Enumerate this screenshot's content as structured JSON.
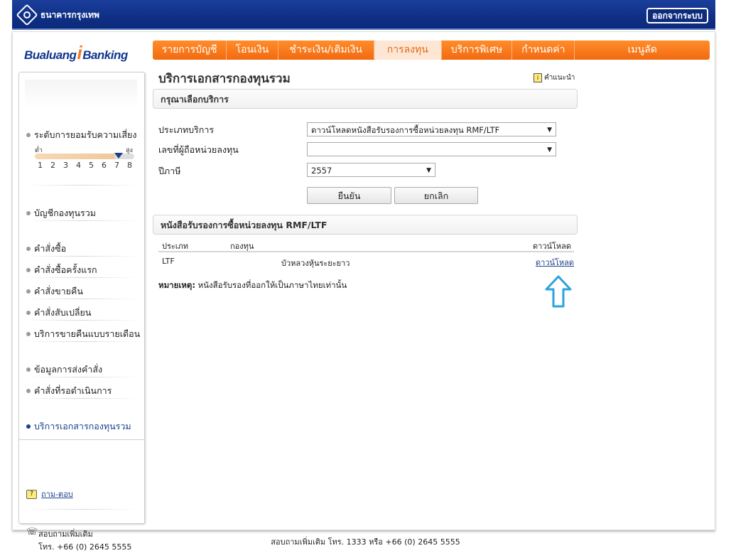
{
  "header": {
    "bank_name": "ธนาคารกรุงเทพ",
    "logout_label": "ออกจากระบบ"
  },
  "brand": {
    "left": "Bualuang",
    "mid": "i",
    "right": "Banking"
  },
  "menu": [
    {
      "label": "รายการบัญชี",
      "active": false
    },
    {
      "label": "โอนเงิน",
      "active": false
    },
    {
      "label": "ชำระเงิน/เติมเงิน",
      "active": false
    },
    {
      "label": "การลงทุน",
      "active": true
    },
    {
      "label": "บริการพิเศษ",
      "active": false
    },
    {
      "label": "กำหนดค่า",
      "active": false
    },
    {
      "label": "เมนูลัด",
      "active": false
    }
  ],
  "sidebar": {
    "risk_title": "ระดับการยอมรับความเสี่ยง",
    "risk_low": "ต่ำ",
    "risk_high": "สูง",
    "risk_scale": [
      "1",
      "2",
      "3",
      "4",
      "5",
      "6",
      "7",
      "8"
    ],
    "risk_level": 7,
    "items": [
      {
        "label": "บัญชีกองทุนรวม"
      },
      {
        "label": "คำสั่งซื้อ"
      },
      {
        "label": "คำสั่งซื้อครั้งแรก"
      },
      {
        "label": "คำสั่งขายคืน"
      },
      {
        "label": "คำสั่งสับเปลี่ยน"
      },
      {
        "label": "บริการขายคืนแบบรายเดือน"
      },
      {
        "label": "ข้อมูลการส่งคำสั่ง"
      },
      {
        "label": "คำสั่งที่รอดำเนินการ"
      },
      {
        "label": "บริการเอกสารกองทุนรวม"
      }
    ],
    "help_icon": "?",
    "help_label": "ถาม-ตอบ",
    "contact_line1": "สอบถามเพิ่มเติม",
    "contact_line2": "โทร. +66 (0) 2645 5555"
  },
  "content": {
    "title": "บริการเอกสารกองทุนรวม",
    "advice_icon": "i",
    "advice_label": "คำแนะนำ",
    "select_section": "กรุณาเลือกบริการ",
    "service_type_label": "ประเภทบริการ",
    "service_type_value": "ดาวน์โหลดหนังสือรับรองการซื้อหน่วยลงทุน RMF/LTF",
    "holder_label": "เลขที่ผู้ถือหน่วยลงทุน",
    "holder_value": "",
    "year_label": "ปีภาษี",
    "year_value": "2557",
    "confirm_label": "ยืนยัน",
    "cancel_label": "ยกเลิก",
    "result_section": "หนังสือรับรองการซื้อหน่วยลงทุน RMF/LTF",
    "table": {
      "headers": [
        "ประเภท",
        "กองทุน",
        "ดาวน์โหลด"
      ],
      "rows": [
        {
          "type": "LTF",
          "fund": "บัวหลวงหุ้นระยะยาว",
          "link": "ดาวน์โหลด"
        }
      ]
    },
    "note_label": "หมายเหตุ:",
    "note_text": "หนังสือรับรองที่ออกให้เป็นภาษาไทยเท่านั้น"
  },
  "footer": "สอบถามเพิ่มเติม โทร. 1333 หรือ +66 (0) 2645 5555",
  "colors": {
    "nav_blue": "#0f2f86",
    "menu_orange": "#f47a20",
    "link_blue": "#1a3f8c",
    "arrow_blue": "#2aa3dc"
  }
}
